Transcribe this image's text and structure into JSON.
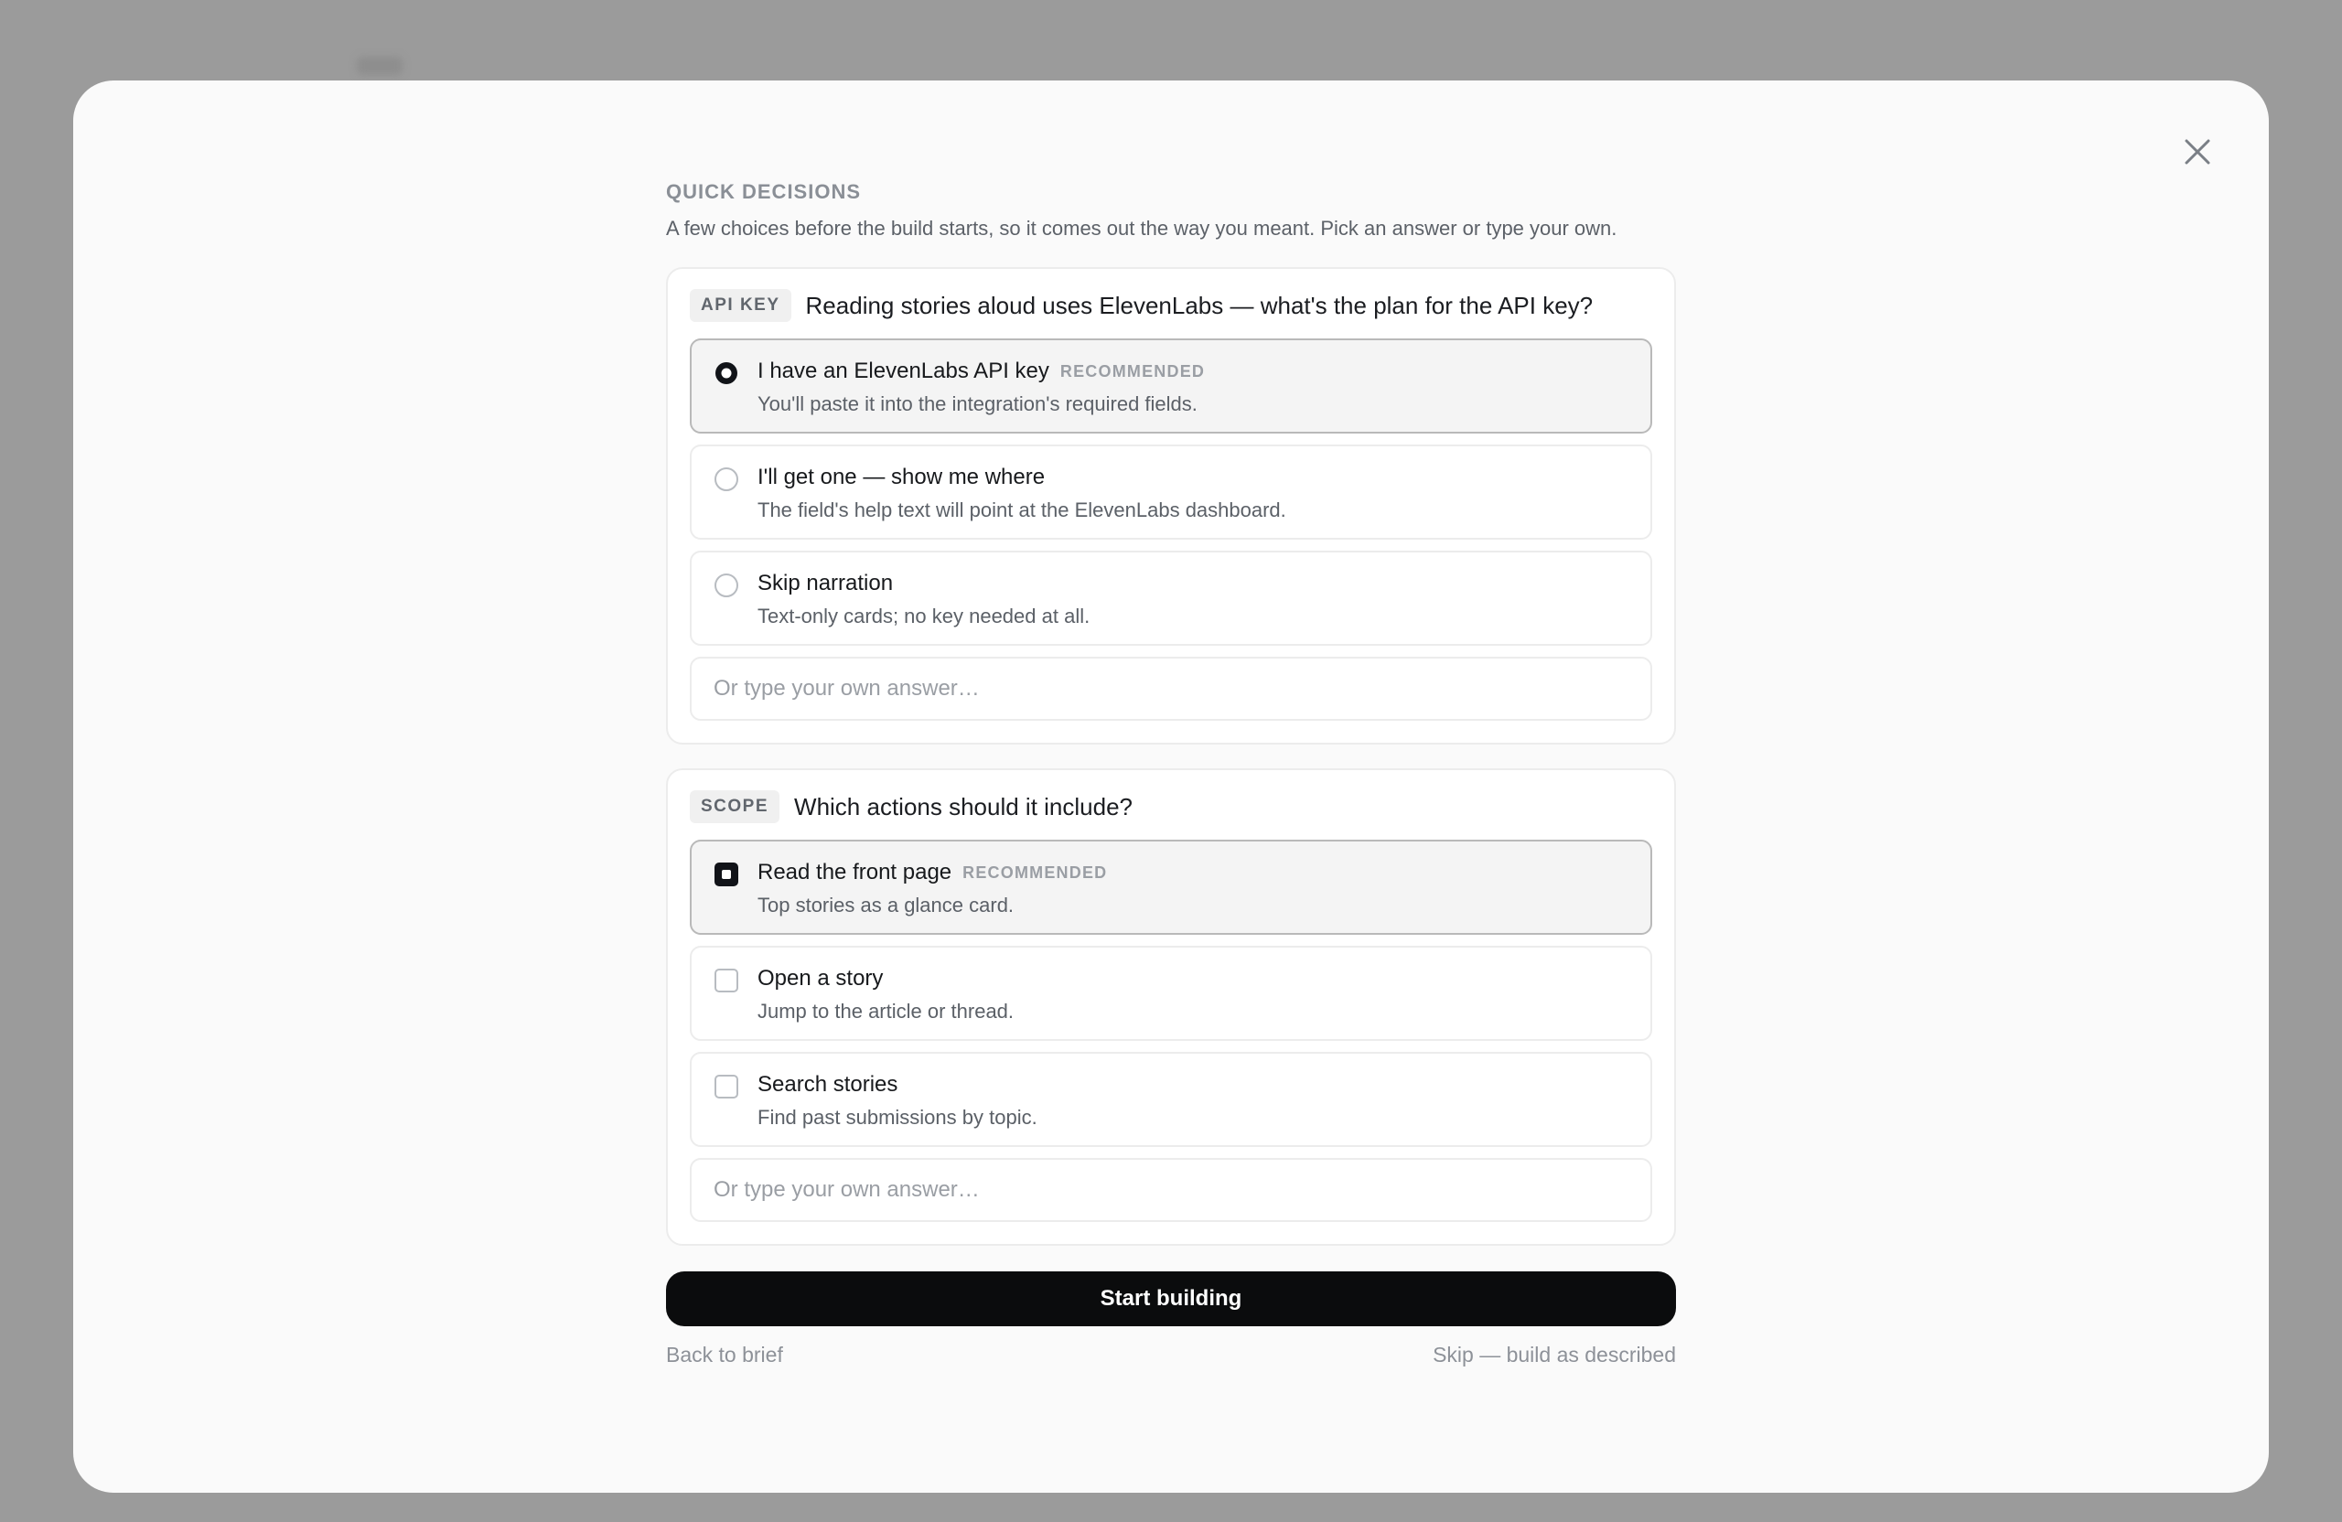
{
  "dialog": {
    "eyebrow": "QUICK DECISIONS",
    "intro": "A few choices before the build starts, so it comes out the way you meant. Pick an answer or type your own.",
    "close_icon": "close-icon"
  },
  "questions": [
    {
      "tag": "API KEY",
      "question": "Reading stories aloud uses ElevenLabs — what's the plan for the API key?",
      "input_type": "radio",
      "options": [
        {
          "title": "I have an ElevenLabs API key",
          "badge": "RECOMMENDED",
          "desc": "You'll paste it into the integration's required fields.",
          "selected": true
        },
        {
          "title": "I'll get one — show me where",
          "badge": "",
          "desc": "The field's help text will point at the ElevenLabs dashboard.",
          "selected": false
        },
        {
          "title": "Skip narration",
          "badge": "",
          "desc": "Text-only cards; no key needed at all.",
          "selected": false
        }
      ],
      "own_placeholder": "Or type your own answer…",
      "own_value": ""
    },
    {
      "tag": "SCOPE",
      "question": "Which actions should it include?",
      "input_type": "checkbox",
      "options": [
        {
          "title": "Read the front page",
          "badge": "RECOMMENDED",
          "desc": "Top stories as a glance card.",
          "selected": true
        },
        {
          "title": "Open a story",
          "badge": "",
          "desc": "Jump to the article or thread.",
          "selected": false
        },
        {
          "title": "Search stories",
          "badge": "",
          "desc": "Find past submissions by topic.",
          "selected": false
        }
      ],
      "own_placeholder": "Or type your own answer…",
      "own_value": ""
    }
  ],
  "actions": {
    "start_label": "Start building",
    "back_label": "Back to brief",
    "skip_label": "Skip — build as described"
  },
  "colors": {
    "overlay": "#9b9b9b",
    "modal_bg": "#fafafa",
    "primary_button": "#0b0c0d",
    "selected_option_bg": "#f4f4f4"
  }
}
